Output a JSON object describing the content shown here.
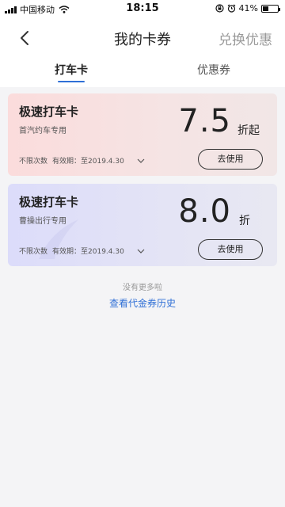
{
  "status_bar": {
    "carrier": "中国移动",
    "time": "18:15",
    "battery_text": "41%",
    "battery_level": 0.41
  },
  "nav": {
    "title": "我的卡券",
    "action": "兑换优惠"
  },
  "tabs": [
    {
      "label": "打车卡",
      "active": true
    },
    {
      "label": "优惠券",
      "active": false
    }
  ],
  "cards": [
    {
      "title": "极速打车卡",
      "subtitle": "首汽约车专用",
      "value": "7.5",
      "unit": "折起",
      "times": "不限次数",
      "validity": "有效期：至2019.4.30",
      "button": "去使用",
      "color": "#fbdcdc"
    },
    {
      "title": "极速打车卡",
      "subtitle": "曹操出行专用",
      "value": "8.0",
      "unit": "折",
      "times": "不限次数",
      "validity": "有效期：至2019.4.30",
      "button": "去使用",
      "color": "#dcdcfa"
    }
  ],
  "footer": {
    "no_more": "没有更多啦",
    "history_link": "查看代金券历史",
    "link_color": "#2f6fd6"
  },
  "icons": {
    "back": "chevron-left-icon",
    "expand": "chevron-down-icon",
    "wifi": "wifi-icon",
    "battery": "battery-icon",
    "lock": "rotation-lock-icon",
    "alarm": "alarm-icon"
  }
}
